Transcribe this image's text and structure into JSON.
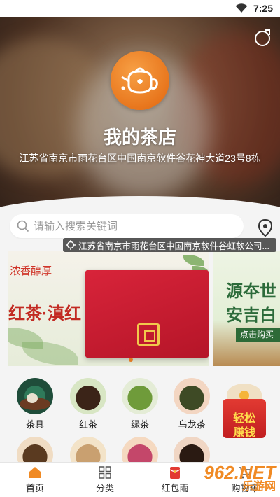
{
  "status_bar": {
    "time": "7:25"
  },
  "shop": {
    "name": "我的茶店",
    "address": "江苏省南京市雨花台区中国南京软件谷花神大道23号8栋"
  },
  "search": {
    "placeholder": "请输入搜索关键词"
  },
  "location_bar": {
    "text": "江苏省南京市雨花台区中国南京软件谷虹软公司..."
  },
  "banner": {
    "line1": "浓香醇厚",
    "line2": "红茶·滇红",
    "side_line1": "源夲世",
    "side_line2": "安吉白",
    "side_button": "点击购买"
  },
  "categories": [
    {
      "label": "茶具"
    },
    {
      "label": "红茶"
    },
    {
      "label": "绿茶"
    },
    {
      "label": "乌龙茶"
    }
  ],
  "red_packet": {
    "line1": "轻松",
    "line2": "赚钱"
  },
  "tabbar": [
    {
      "label": "首页"
    },
    {
      "label": "分类"
    },
    {
      "label": "红包雨"
    },
    {
      "label": "购物车"
    }
  ],
  "watermark": {
    "line1": "962.NET",
    "line2": "乐游网"
  },
  "colors": {
    "accent": "#e8761d",
    "brand_red": "#d0362a",
    "tab_active": "#f08a24"
  }
}
